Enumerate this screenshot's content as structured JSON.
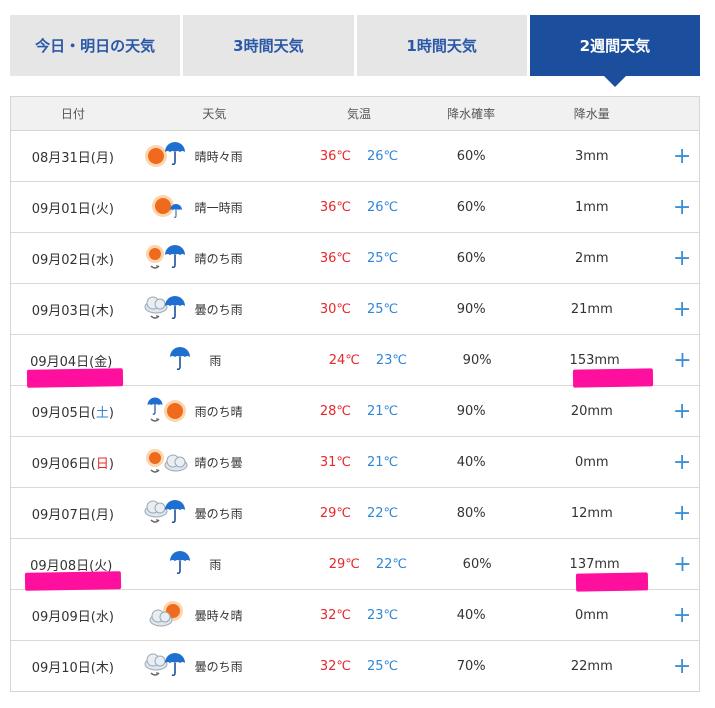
{
  "tabs": [
    {
      "label": "今日・明日の天気",
      "active": false
    },
    {
      "label": "3時間天気",
      "active": false
    },
    {
      "label": "1時間天気",
      "active": false
    },
    {
      "label": "2週間天気",
      "active": true
    }
  ],
  "headers": {
    "date": "日付",
    "weather": "天気",
    "temp": "気温",
    "prob": "降水確率",
    "amount": "降水量"
  },
  "rows": [
    {
      "date": "08月31日(月)",
      "icon": "sun-umbrella-icon",
      "weather": "晴時々雨",
      "hi": "36℃",
      "lo": "26℃",
      "prob": "60%",
      "amount": "3mm"
    },
    {
      "date": "09月01日(火)",
      "icon": "sun-umbrella-small-icon",
      "weather": "晴一時雨",
      "hi": "36℃",
      "lo": "26℃",
      "prob": "60%",
      "amount": "1mm"
    },
    {
      "date": "09月02日(水)",
      "icon": "sun-then-umbrella-icon",
      "weather": "晴のち雨",
      "hi": "36℃",
      "lo": "25℃",
      "prob": "60%",
      "amount": "2mm"
    },
    {
      "date": "09月03日(木)",
      "icon": "cloud-then-umbrella-icon",
      "weather": "曇のち雨",
      "hi": "30℃",
      "lo": "25℃",
      "prob": "90%",
      "amount": "21mm"
    },
    {
      "date": "09月04日(金)",
      "icon": "umbrella-icon",
      "weather": "雨",
      "hi": "24℃",
      "lo": "23℃",
      "prob": "90%",
      "amount": "153mm"
    },
    {
      "date_pre": "09月05日(",
      "date_day": "土",
      "date_post": ")",
      "date_class": "sat",
      "icon": "umbrella-then-sun-icon",
      "weather": "雨のち晴",
      "hi": "28℃",
      "lo": "21℃",
      "prob": "90%",
      "amount": "20mm"
    },
    {
      "date_pre": "09月06日(",
      "date_day": "日",
      "date_post": ")",
      "date_class": "sun",
      "icon": "sun-then-cloud-icon",
      "weather": "晴のち曇",
      "hi": "31℃",
      "lo": "21℃",
      "prob": "40%",
      "amount": "0mm"
    },
    {
      "date": "09月07日(月)",
      "icon": "cloud-then-umbrella-icon",
      "weather": "曇のち雨",
      "hi": "29℃",
      "lo": "22℃",
      "prob": "80%",
      "amount": "12mm"
    },
    {
      "date": "09月08日(火)",
      "icon": "umbrella-icon",
      "weather": "雨",
      "hi": "29℃",
      "lo": "22℃",
      "prob": "60%",
      "amount": "137mm"
    },
    {
      "date": "09月09日(水)",
      "icon": "cloud-sun-icon",
      "weather": "曇時々晴",
      "hi": "32℃",
      "lo": "23℃",
      "prob": "40%",
      "amount": "0mm"
    },
    {
      "date": "09月10日(木)",
      "icon": "cloud-then-umbrella-icon",
      "weather": "曇のち雨",
      "hi": "32℃",
      "lo": "25℃",
      "prob": "70%",
      "amount": "22mm"
    }
  ],
  "plus_label": "+",
  "colors": {
    "tab_active": "#1b4f9e",
    "tab_text": "#2a58a7",
    "high_temp": "#e8262b",
    "low_temp": "#2f86d8",
    "highlight": "#ff0f9e"
  }
}
